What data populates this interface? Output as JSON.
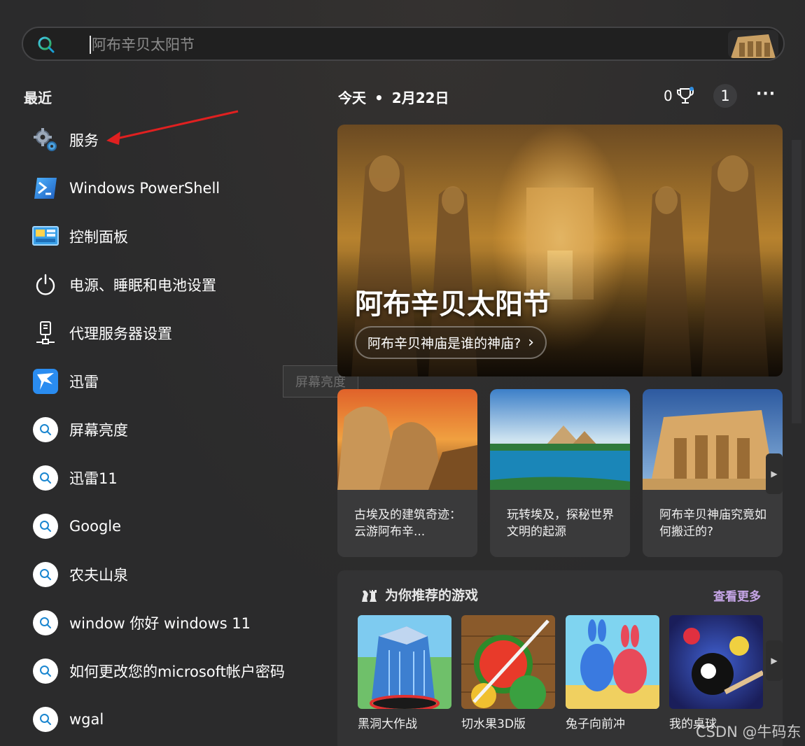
{
  "search": {
    "placeholder": "阿布辛贝太阳节"
  },
  "recent": {
    "title": "最近",
    "items": [
      {
        "label": "服务",
        "icon": "gears-icon"
      },
      {
        "label": "Windows PowerShell",
        "icon": "powershell-icon"
      },
      {
        "label": "控制面板",
        "icon": "control-panel-icon"
      },
      {
        "label": "电源、睡眠和电池设置",
        "icon": "power-icon"
      },
      {
        "label": "代理服务器设置",
        "icon": "proxy-icon"
      },
      {
        "label": "迅雷",
        "icon": "xunlei-icon"
      },
      {
        "label": "屏幕亮度",
        "icon": "search-icon"
      },
      {
        "label": "迅雷11",
        "icon": "search-icon"
      },
      {
        "label": "Google",
        "icon": "search-icon"
      },
      {
        "label": "农夫山泉",
        "icon": "search-icon"
      },
      {
        "label": "window 你好 windows 11",
        "icon": "search-icon"
      },
      {
        "label": "如何更改您的microsoft帐户密码",
        "icon": "search-icon"
      },
      {
        "label": "wgal",
        "icon": "search-icon"
      }
    ]
  },
  "tooltip": "屏幕亮度",
  "header": {
    "today": "今天",
    "dot": "•",
    "date": "2月22日",
    "points": "0",
    "badge": "1",
    "more": "···"
  },
  "hero": {
    "title": "阿布辛贝太阳节",
    "button": "阿布辛贝神庙是谁的神庙?",
    "chevron": "›"
  },
  "cards": [
    {
      "text": "古埃及的建筑奇迹：云游阿布辛..."
    },
    {
      "text": "玩转埃及，探秘世界文明的起源"
    },
    {
      "text": "阿布辛贝神庙究竟如何搬迁的?"
    }
  ],
  "games": {
    "title": "为你推荐的游戏",
    "more": "查看更多",
    "items": [
      {
        "label": "黑洞大作战"
      },
      {
        "label": "切水果3D版"
      },
      {
        "label": "兔子向前冲"
      },
      {
        "label": "我的桌球"
      }
    ]
  },
  "watermark": "CSDN @牛码东",
  "colors": {
    "background": "#2b2b2c",
    "accent_link": "#c7a6e8",
    "search_ring": "#1a9fd6",
    "arrow": "#e02020"
  }
}
